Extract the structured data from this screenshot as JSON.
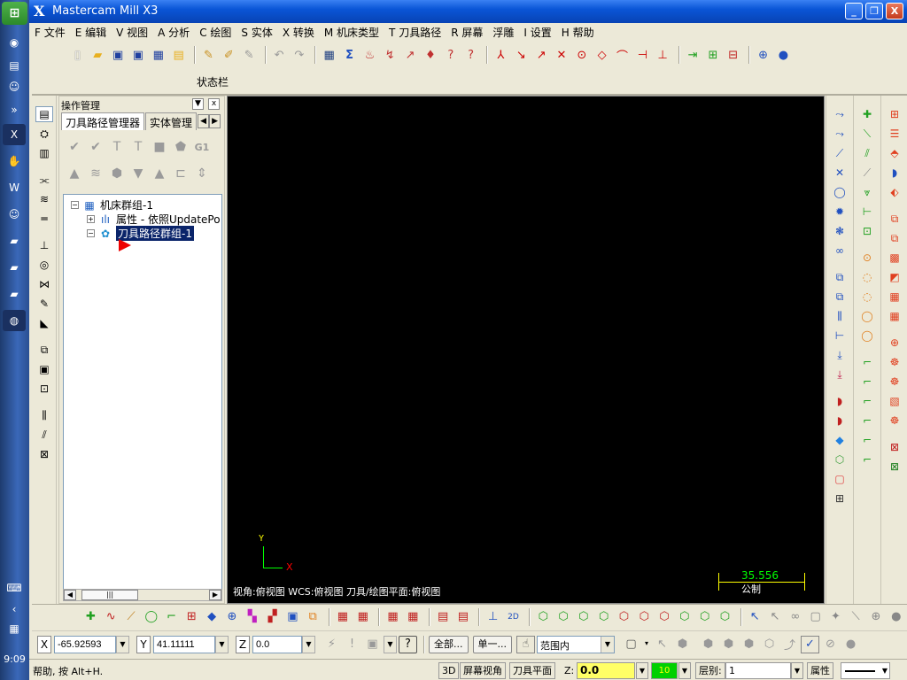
{
  "window": {
    "title": "Mastercam Mill X3",
    "logo": "X",
    "controls": {
      "minimize": "_",
      "restore": "❐",
      "close": "X"
    }
  },
  "taskbar": {
    "start": "⊞",
    "clock": "9:09"
  },
  "menu": [
    "F 文件",
    "E 编辑",
    "V 视图",
    "A 分析",
    "C 绘图",
    "S 实体",
    "X 转换",
    "M 机床类型",
    "T 刀具路径",
    "R 屏幕",
    "浮雕",
    "I 设置",
    "H 帮助"
  ],
  "toolbar": {
    "status_label": "状态栏"
  },
  "ops_manager": {
    "title": "操作管理",
    "tabs": [
      "刀具路径管理器",
      "实体管理"
    ],
    "g1_label": "G1",
    "tree": [
      {
        "label": "机床群组-1",
        "expander": "−"
      },
      {
        "label": "属性 - 依照UpdatePo",
        "expander": "+"
      },
      {
        "label": "刀具路径群组-1",
        "expander": "−",
        "selected": true
      }
    ]
  },
  "viewport": {
    "axis_y": "Y",
    "axis_x": "X",
    "view_info": "视角:俯视图   WCS:俯视图   刀具/绘图平面:俯视图",
    "scale_value": "35.556",
    "scale_unit": "公制"
  },
  "coords": {
    "x_label": "X",
    "x_value": "-65.92593",
    "y_label": "Y",
    "y_value": "41.11111",
    "z_label": "Z",
    "z_value": "0.0",
    "btn_all": "全部...",
    "btn_single": "单一...",
    "range": "范围内"
  },
  "statusbar": {
    "help": "帮助, 按 Alt+H.",
    "btn_3d": "3D",
    "screen_view": "屏幕视角",
    "tool_plane": "刀具平面",
    "z_label": "Z:",
    "z_value": "0.0",
    "color_num": "10",
    "level_label": "层别:",
    "level_value": "1",
    "attributes": "属性"
  },
  "colors": {
    "viewport_bg": "#000000",
    "titlebar": "#0a55d6",
    "selection": "#0a246a"
  }
}
